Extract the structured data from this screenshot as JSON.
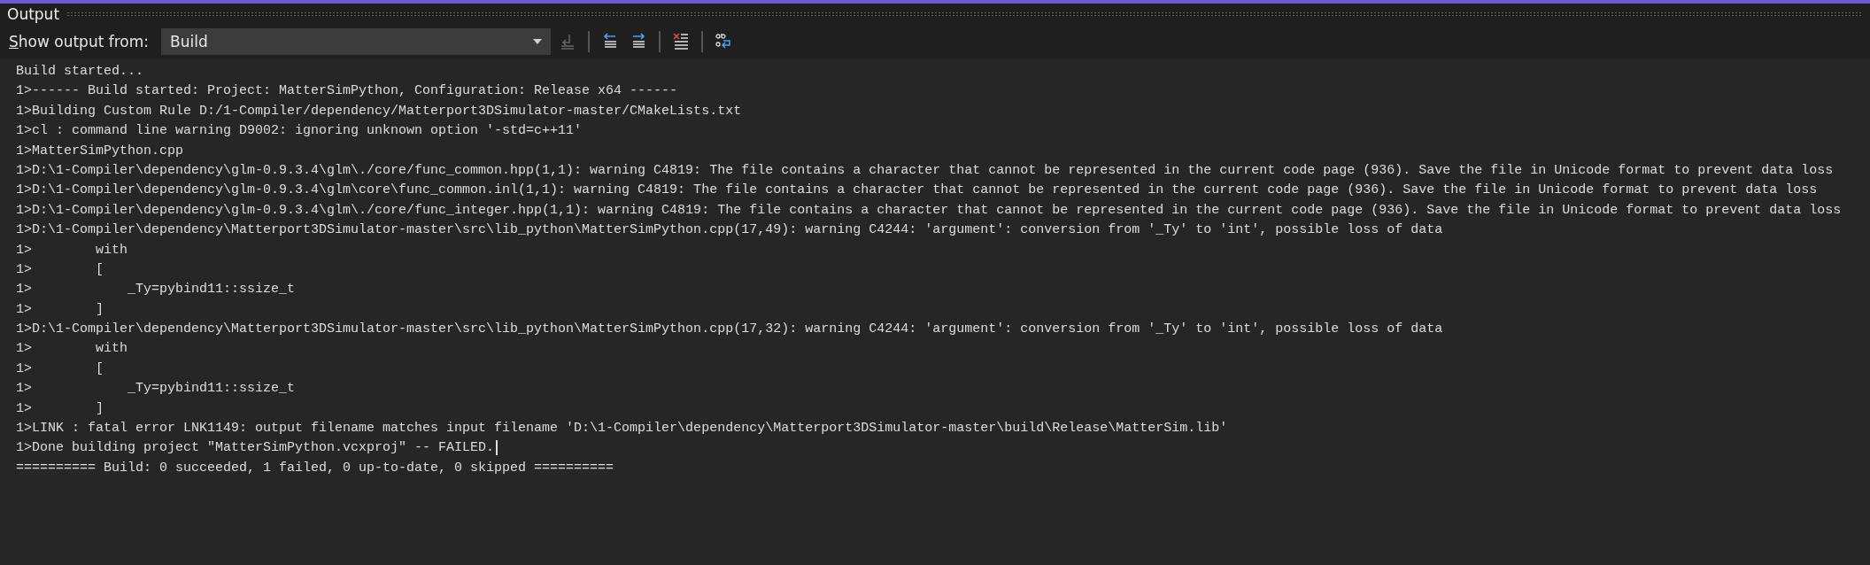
{
  "panel": {
    "title": "Output"
  },
  "toolbar": {
    "label": "Show output from:",
    "source": "Build",
    "buttons": [
      {
        "kind": "goto",
        "disabled": true
      },
      {
        "kind": "sep"
      },
      {
        "kind": "prev",
        "disabled": false
      },
      {
        "kind": "next",
        "disabled": false
      },
      {
        "kind": "sep"
      },
      {
        "kind": "clear",
        "disabled": false
      },
      {
        "kind": "sep"
      },
      {
        "kind": "wrap",
        "disabled": false
      }
    ]
  },
  "lines": [
    {
      "text": "Build started...",
      "caret": false
    },
    {
      "text": "1>------ Build started: Project: MatterSimPython, Configuration: Release x64 ------",
      "caret": false
    },
    {
      "text": "1>Building Custom Rule D:/1-Compiler/dependency/Matterport3DSimulator-master/CMakeLists.txt",
      "caret": false
    },
    {
      "text": "1>cl : command line warning D9002: ignoring unknown option '-std=c++11'",
      "caret": false
    },
    {
      "text": "1>MatterSimPython.cpp",
      "caret": false
    },
    {
      "text": "1>D:\\1-Compiler\\dependency\\glm-0.9.3.4\\glm\\./core/func_common.hpp(1,1): warning C4819: The file contains a character that cannot be represented in the current code page (936). Save the file in Unicode format to prevent data loss",
      "caret": false
    },
    {
      "text": "1>D:\\1-Compiler\\dependency\\glm-0.9.3.4\\glm\\core\\func_common.inl(1,1): warning C4819: The file contains a character that cannot be represented in the current code page (936). Save the file in Unicode format to prevent data loss",
      "caret": false
    },
    {
      "text": "1>D:\\1-Compiler\\dependency\\glm-0.9.3.4\\glm\\./core/func_integer.hpp(1,1): warning C4819: The file contains a character that cannot be represented in the current code page (936). Save the file in Unicode format to prevent data loss",
      "caret": false
    },
    {
      "text": "1>D:\\1-Compiler\\dependency\\Matterport3DSimulator-master\\src\\lib_python\\MatterSimPython.cpp(17,49): warning C4244: 'argument': conversion from '_Ty' to 'int', possible loss of data",
      "caret": false
    },
    {
      "text": "1>        with",
      "caret": false
    },
    {
      "text": "1>        [",
      "caret": false
    },
    {
      "text": "1>            _Ty=pybind11::ssize_t",
      "caret": false
    },
    {
      "text": "1>        ]",
      "caret": false
    },
    {
      "text": "1>D:\\1-Compiler\\dependency\\Matterport3DSimulator-master\\src\\lib_python\\MatterSimPython.cpp(17,32): warning C4244: 'argument': conversion from '_Ty' to 'int', possible loss of data",
      "caret": false
    },
    {
      "text": "1>        with",
      "caret": false
    },
    {
      "text": "1>        [",
      "caret": false
    },
    {
      "text": "1>            _Ty=pybind11::ssize_t",
      "caret": false
    },
    {
      "text": "1>        ]",
      "caret": false
    },
    {
      "text": "1>LINK : fatal error LNK1149: output filename matches input filename 'D:\\1-Compiler\\dependency\\Matterport3DSimulator-master\\build\\Release\\MatterSim.lib'",
      "caret": false
    },
    {
      "text": "1>Done building project \"MatterSimPython.vcxproj\" -- FAILED.",
      "caret": true
    },
    {
      "text": "========== Build: 0 succeeded, 1 failed, 0 up-to-date, 0 skipped ==========",
      "caret": false
    }
  ]
}
